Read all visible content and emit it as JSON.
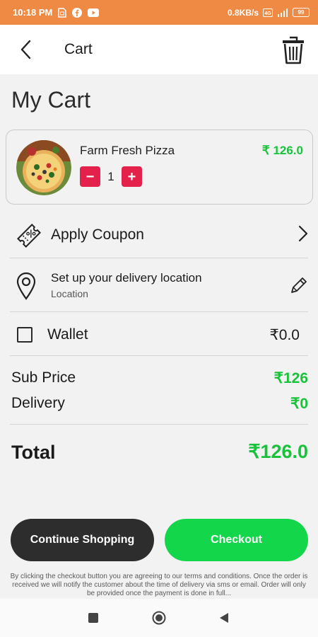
{
  "status_bar": {
    "time": "10:18 PM",
    "net_speed": "0.8KB/s",
    "battery": "99"
  },
  "app_bar": {
    "title": "Cart"
  },
  "page": {
    "title": "My Cart"
  },
  "cart_items": [
    {
      "name": "Farm Fresh Pizza",
      "price": "₹ 126.0",
      "quantity": "1",
      "decrement": "−",
      "increment": "+"
    }
  ],
  "coupon": {
    "label": "Apply Coupon"
  },
  "delivery_location": {
    "title": "Set up your delivery location",
    "subtitle": "Location"
  },
  "wallet": {
    "label": "Wallet",
    "value": "₹0.0",
    "checked": false
  },
  "summary": {
    "sub_price_label": "Sub Price",
    "sub_price_value": "₹126",
    "delivery_label": "Delivery",
    "delivery_value": "₹0",
    "total_label": "Total",
    "total_value": "₹126.0"
  },
  "buttons": {
    "continue_shopping": "Continue Shopping",
    "checkout": "Checkout"
  },
  "disclaimer": "By clicking the checkout button you are agreeing to our terms and conditions. Once the order is received we will notify the customer about the time of delivery via sms or email. Order will only be provided once the payment is done in full...",
  "colors": {
    "status_bar": "#ef8a45",
    "price_green": "#19c23a",
    "checkout_green": "#13d64a",
    "qty_red": "#e3214a",
    "dark_button": "#2d2d2d"
  }
}
